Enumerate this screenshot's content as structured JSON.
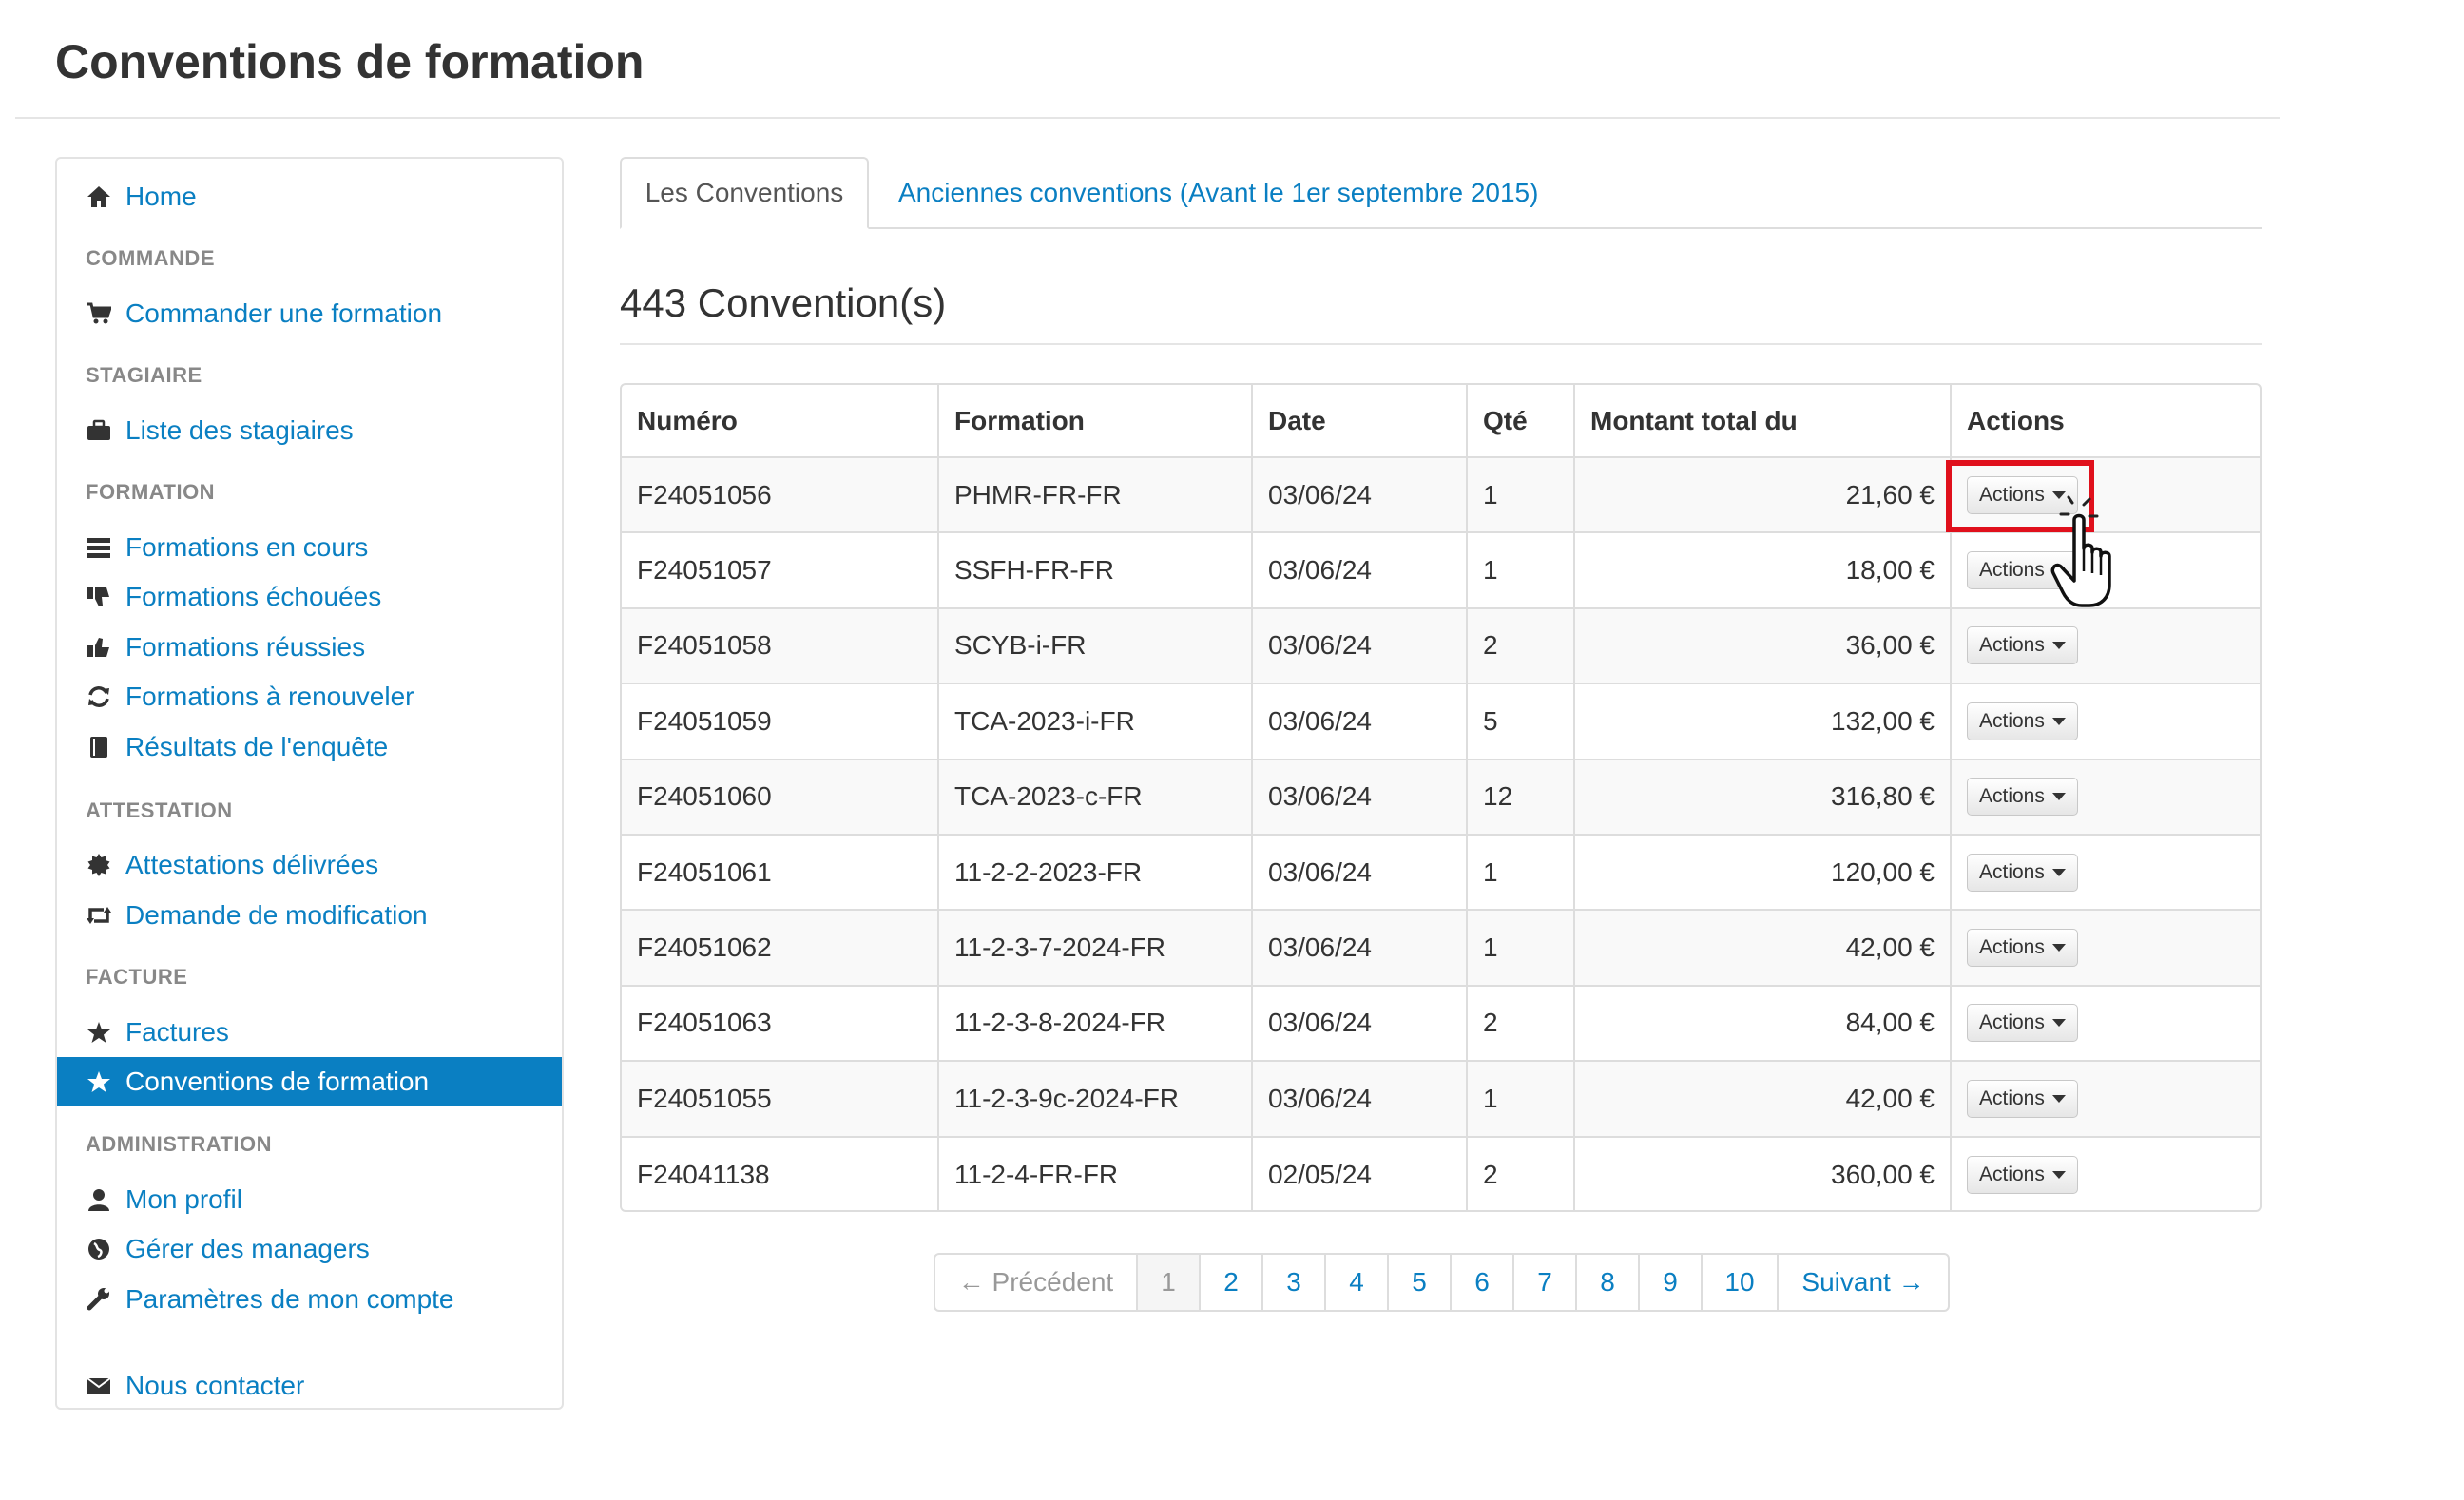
{
  "page_title": "Conventions de formation",
  "sidebar": {
    "home": "Home",
    "sections": [
      {
        "header": "COMMANDE",
        "items": [
          "Commander une formation"
        ]
      },
      {
        "header": "STAGIAIRE",
        "items": [
          "Liste des stagiaires"
        ]
      },
      {
        "header": "FORMATION",
        "items": [
          "Formations en cours",
          "Formations échouées",
          "Formations réussies",
          "Formations à renouveler",
          "Résultats de l'enquête"
        ]
      },
      {
        "header": "ATTESTATION",
        "items": [
          "Attestations délivrées",
          "Demande de modification"
        ]
      },
      {
        "header": "FACTURE",
        "items": [
          "Factures",
          "Conventions de formation"
        ]
      },
      {
        "header": "ADMINISTRATION",
        "items": [
          "Mon profil",
          "Gérer des managers",
          "Paramètres de mon compte"
        ]
      }
    ],
    "contact": "Nous contacter",
    "active_item": "Conventions de formation"
  },
  "tabs": [
    "Les Conventions",
    "Anciennes conventions (Avant le 1er septembre 2015)"
  ],
  "count_title": "443 Convention(s)",
  "table": {
    "headers": [
      "Numéro",
      "Formation",
      "Date",
      "Qté",
      "Montant total du",
      "Actions"
    ],
    "rows": [
      [
        "F24051056",
        "PHMR-FR-FR",
        "03/06/24",
        "1",
        "21,60 €"
      ],
      [
        "F24051057",
        "SSFH-FR-FR",
        "03/06/24",
        "1",
        "18,00 €"
      ],
      [
        "F24051058",
        "SCYB-i-FR",
        "03/06/24",
        "2",
        "36,00 €"
      ],
      [
        "F24051059",
        "TCA-2023-i-FR",
        "03/06/24",
        "5",
        "132,00 €"
      ],
      [
        "F24051060",
        "TCA-2023-c-FR",
        "03/06/24",
        "12",
        "316,80 €"
      ],
      [
        "F24051061",
        "11-2-2-2023-FR",
        "03/06/24",
        "1",
        "120,00 €"
      ],
      [
        "F24051062",
        "11-2-3-7-2024-FR",
        "03/06/24",
        "1",
        "42,00 €"
      ],
      [
        "F24051063",
        "11-2-3-8-2024-FR",
        "03/06/24",
        "2",
        "84,00 €"
      ],
      [
        "F24051055",
        "11-2-3-9c-2024-FR",
        "03/06/24",
        "1",
        "42,00 €"
      ],
      [
        "F24041138",
        "11-2-4-FR-FR",
        "02/05/24",
        "2",
        "360,00 €"
      ]
    ],
    "action_label": "Actions"
  },
  "pagination": {
    "prev": "← Précédent",
    "pages": [
      "1",
      "2",
      "3",
      "4",
      "5",
      "6",
      "7",
      "8",
      "9",
      "10"
    ],
    "current": "1",
    "next": "Suivant →"
  },
  "colors": {
    "link": "#0a7fc2",
    "active_bg": "#0a7fc2",
    "highlight": "#e0101c"
  }
}
